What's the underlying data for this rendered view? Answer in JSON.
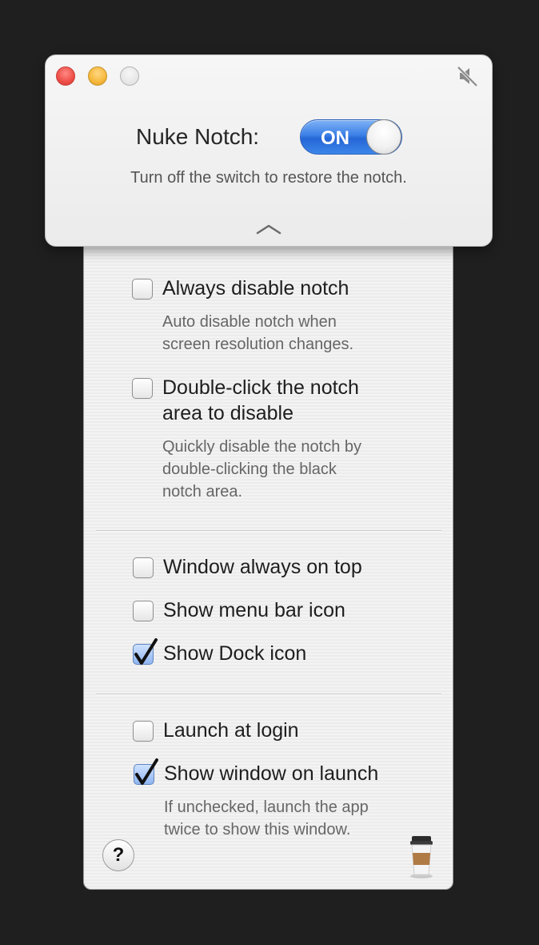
{
  "header": {
    "title_label": "Nuke Notch:",
    "toggle_label": "ON",
    "subtitle": "Turn off the switch to restore the notch."
  },
  "options": {
    "always_disable": {
      "label": "Always disable notch",
      "checked": false,
      "desc_line1": "Auto disable notch when",
      "desc_line2": "screen resolution changes."
    },
    "double_click": {
      "label_line1": "Double-click the notch",
      "label_line2": "area to disable",
      "checked": false,
      "desc_line1": "Quickly disable the notch by",
      "desc_line2": "double-clicking the black",
      "desc_line3": "notch area."
    },
    "window_on_top": {
      "label": "Window always on top",
      "checked": false
    },
    "menu_bar_icon": {
      "label": "Show menu bar icon",
      "checked": false
    },
    "dock_icon": {
      "label": "Show Dock icon",
      "checked": true
    },
    "launch_at_login": {
      "label": "Launch at login",
      "checked": false
    },
    "show_window_on_launch": {
      "label": "Show window on launch",
      "checked": true,
      "desc_line1": "If unchecked, launch the app",
      "desc_line2": "twice to show this window."
    }
  },
  "footer": {
    "help_label": "?"
  },
  "icons": {
    "mute": "speaker-muted-icon",
    "chevron": "chevron-up-icon",
    "coffee": "coffee-cup-icon"
  },
  "colors": {
    "toggle_on": "#2f74e0",
    "checkbox_checked": "#8fb5f0"
  }
}
